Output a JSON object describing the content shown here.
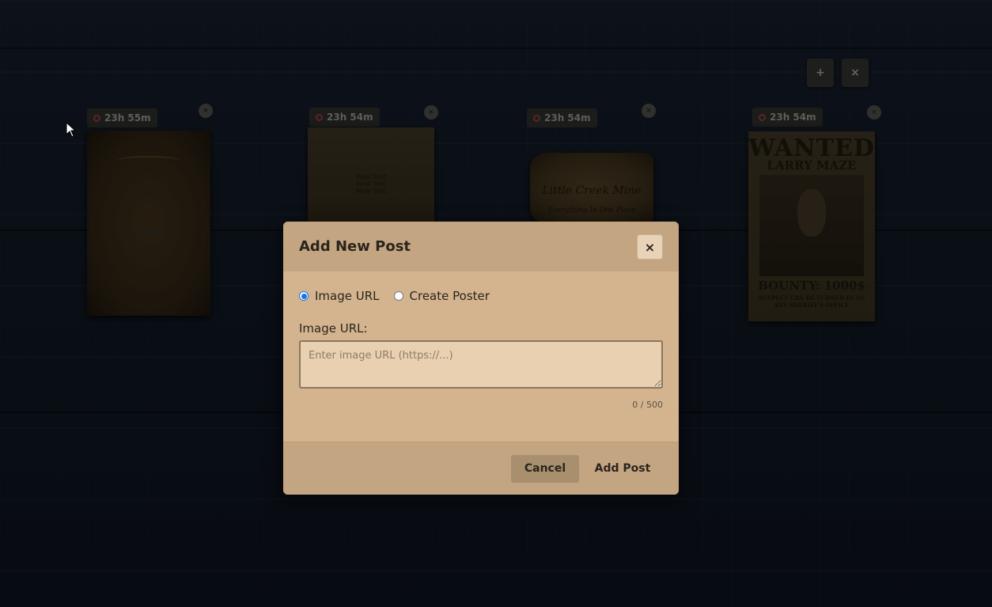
{
  "toolbar": {
    "add_label": "+",
    "close_label": "×"
  },
  "posts": [
    {
      "timer": "23h 55m",
      "remove_label": "×",
      "text": "New Text"
    },
    {
      "timer": "23h 54m",
      "remove_label": "×",
      "text_lines": [
        "New Text",
        "New Text",
        "New Text"
      ]
    },
    {
      "timer": "23h 54m",
      "remove_label": "×",
      "title": "Little Creek Mine",
      "subtitle": "Everything In One Place"
    },
    {
      "timer": "23h 54m",
      "remove_label": "×",
      "heading": "WANTED",
      "name": "LARRY MAZE",
      "bounty": "BOUNTY: 1000$",
      "note": "SUSPECT CAN BE TURNED IN TO ANY SHERIFF'S OFFICE"
    }
  ],
  "modal": {
    "title": "Add New Post",
    "close_label": "×",
    "options": [
      {
        "label": "Image URL",
        "checked": true
      },
      {
        "label": "Create Poster",
        "checked": false
      }
    ],
    "field_label": "Image URL:",
    "url_placeholder": "Enter image URL (https://...)",
    "url_value": "",
    "counter": "0 / 500",
    "cancel_label": "Cancel",
    "submit_label": "Add Post"
  },
  "colors": {
    "modal_bg": "#d4b48f",
    "modal_header": "#c4a582",
    "radio_accent": "#1a73e8"
  }
}
